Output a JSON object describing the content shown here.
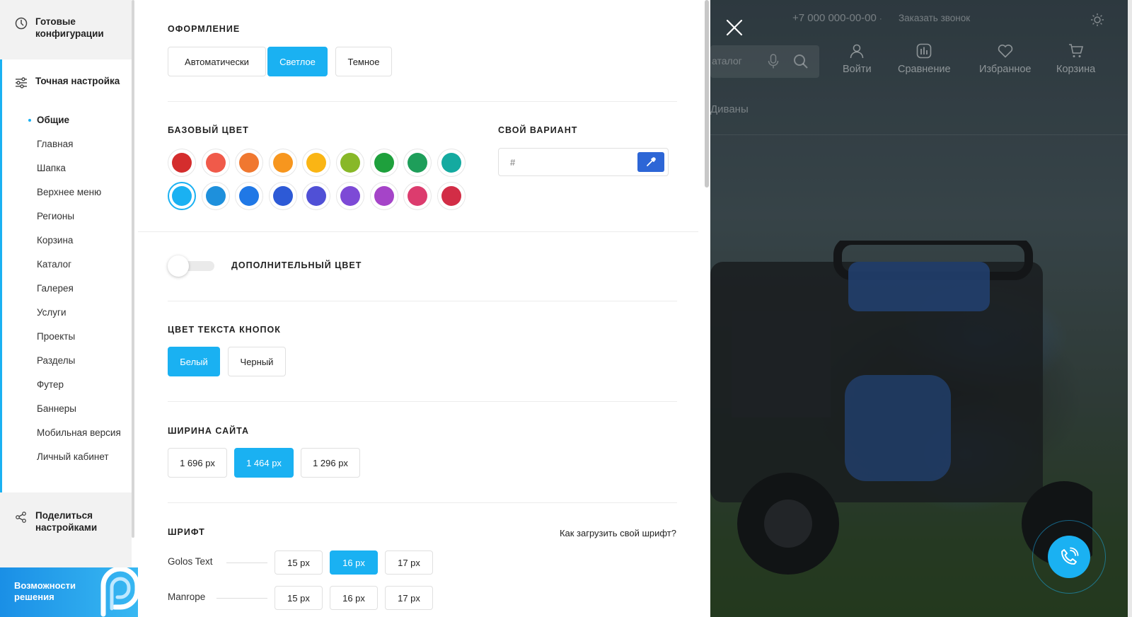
{
  "nav": {
    "ready_configs": "Готовые конфигурации",
    "fine_tuning": "Точная настройка",
    "items": [
      "Общие",
      "Главная",
      "Шапка",
      "Верхнее меню",
      "Регионы",
      "Корзина",
      "Каталог",
      "Галерея",
      "Услуги",
      "Проекты",
      "Разделы",
      "Футер",
      "Баннеры",
      "Мобильная версия",
      "Личный кабинет"
    ],
    "active_index": 0,
    "share": "Поделиться настройками",
    "banner_text": "Возможности решения"
  },
  "theme": {
    "title": "ОФОРМЛЕНИЕ",
    "options": [
      "Автоматически",
      "Светлое",
      "Темное"
    ],
    "selected": "Светлое"
  },
  "base_color": {
    "title": "БАЗОВЫЙ ЦВЕТ",
    "swatches_row1": [
      "#d42d2d",
      "#f05a4a",
      "#f07830",
      "#f7961e",
      "#fab514",
      "#88b828",
      "#1ea03c",
      "#1e9e5a",
      "#14aaa0"
    ],
    "swatches_row2": [
      "#1ab1f2",
      "#1e90dc",
      "#2078e6",
      "#2d5ad6",
      "#5050d6",
      "#7d4ad6",
      "#a544c8",
      "#dc3c6e",
      "#d22d46"
    ],
    "selected": "#1ab1f2",
    "custom_title": "СВОЙ ВАРИАНТ",
    "custom_placeholder": "#"
  },
  "extra_color": {
    "title": "ДОПОЛНИТЕЛЬНЫЙ ЦВЕТ",
    "enabled": false
  },
  "button_text": {
    "title": "ЦВЕТ ТЕКСТА КНОПОК",
    "options": [
      "Белый",
      "Черный"
    ],
    "selected": "Белый"
  },
  "site_width": {
    "title": "ШИРИНА САЙТА",
    "options": [
      "1 696 px",
      "1 464 px",
      "1 296 px"
    ],
    "selected": "1 464 px"
  },
  "font": {
    "title": "ШРИФТ",
    "upload_link": "Как загрузить свой шрифт?",
    "fonts": [
      {
        "name": "Golos Text",
        "sizes": [
          "15 px",
          "16 px",
          "17 px"
        ],
        "selected": "16 px"
      },
      {
        "name": "Manrope",
        "sizes": [
          "15 px",
          "16 px",
          "17 px"
        ],
        "selected": null
      }
    ]
  },
  "preview": {
    "phone": "+7 000 000-00-00",
    "phone_suffix": "·",
    "call_link": "Заказать звонок",
    "search_placeholder": "аталог",
    "nav": [
      "Войти",
      "Сравнение",
      "Избранное",
      "Корзина"
    ],
    "menu_item": "Диваны"
  },
  "colors": {
    "accent": "#1ab1f2",
    "picker": "#2d66d6"
  }
}
